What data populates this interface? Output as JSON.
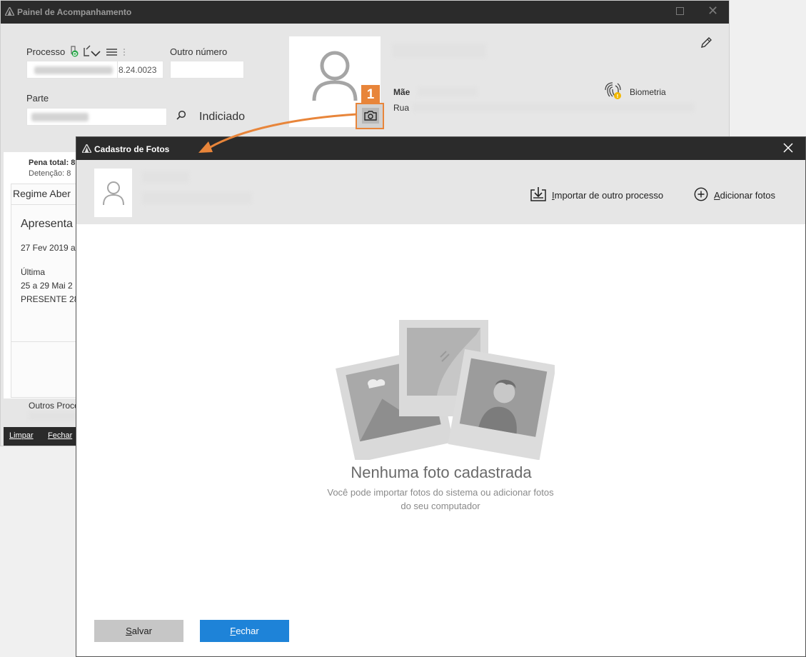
{
  "background_window": {
    "title": "Painel de Acompanhamento",
    "processo_label": "Processo",
    "processo_suffix": "8.24.0023",
    "outro_numero_label": "Outro número",
    "parte_label": "Parte",
    "indiciado_label": "Indiciado",
    "mae_label": "Mãe",
    "rua_label": "Rua",
    "biometria_label": "Biometria",
    "callout_number": "1",
    "pena_total": "Pena total: 8",
    "detencao": "Detenção: 8",
    "regime": "Regime Aber",
    "apresenta": "Apresenta",
    "date1": "27 Fev 2019 a",
    "ultima": "Última",
    "date2": "25 a 29 Mai 2",
    "presente": "PRESENTE 28",
    "outros_processos": "Outros Proce",
    "footer": {
      "limpar": "Limpar",
      "fechar": "Fechar"
    }
  },
  "modal": {
    "title": "Cadastro de Fotos",
    "actions": {
      "import_first": "I",
      "import_rest": "mportar de outro processo",
      "add_first": "A",
      "add_rest": "dicionar fotos"
    },
    "empty_state": {
      "title": "Nenhuma foto cadastrada",
      "subtitle": "Você pode importar fotos do sistema ou adicionar fotos do seu computador"
    },
    "buttons": {
      "save_first": "S",
      "save_rest": "alvar",
      "close_first": "F",
      "close_rest": "echar"
    }
  },
  "colors": {
    "accent_orange": "#e8853a",
    "primary_blue": "#1e83d8",
    "titlebar": "#2b2b2b"
  }
}
